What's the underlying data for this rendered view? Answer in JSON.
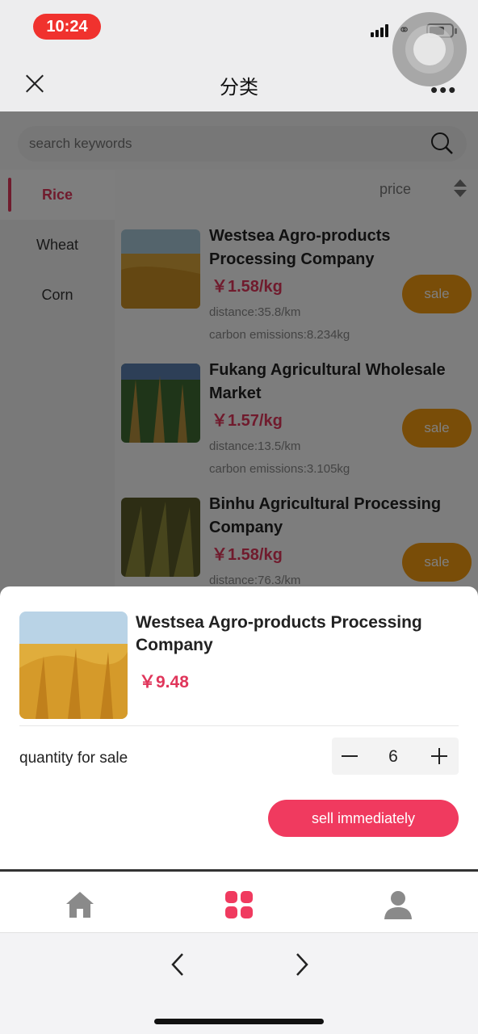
{
  "status_bar": {
    "time": "10:24"
  },
  "nav": {
    "title": "分类",
    "more": "•••"
  },
  "search": {
    "placeholder": "search keywords"
  },
  "sidebar": {
    "items": [
      {
        "label": "Rice"
      },
      {
        "label": "Wheat"
      },
      {
        "label": "Corn"
      }
    ]
  },
  "sort": {
    "label": "price"
  },
  "products": [
    {
      "name": "Westsea Agro-products Processing Company",
      "price": "￥1.58/kg",
      "distance": "distance:35.8/km",
      "carbon": "carbon emissions:8.234kg",
      "action": "sale"
    },
    {
      "name": "Fukang Agricultural Wholesale Market",
      "price": "￥1.57/kg",
      "distance": "distance:13.5/km",
      "carbon": "carbon emissions:3.105kg",
      "action": "sale"
    },
    {
      "name": "Binhu Agricultural Processing Company",
      "price": "￥1.58/kg",
      "distance": "distance:76.3/km",
      "carbon": "",
      "action": "sale"
    }
  ],
  "sheet": {
    "name": "Westsea Agro-products Processing Company",
    "price": "￥9.48",
    "quantity_label": "quantity for sale",
    "quantity": "6",
    "sell_label": "sell immediately"
  },
  "tabbar": {
    "items": [
      {
        "icon": "home-icon"
      },
      {
        "icon": "category-grid-icon",
        "active": true
      },
      {
        "icon": "user-icon"
      }
    ]
  },
  "colors": {
    "accent": "#e0365b",
    "sale": "#f39a11",
    "sell_button": "#f03a5f"
  }
}
